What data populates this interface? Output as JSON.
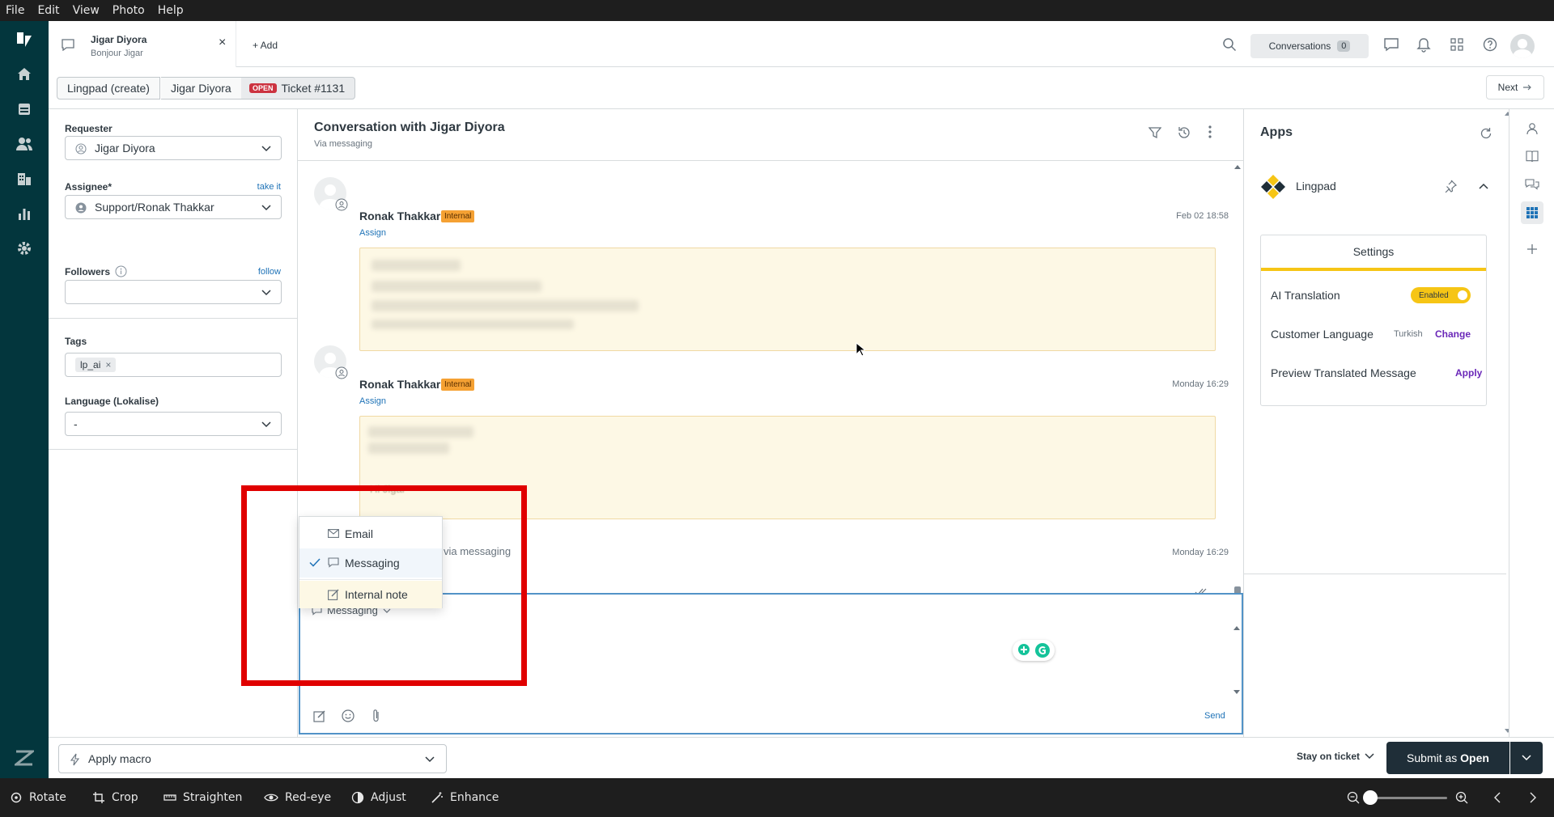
{
  "menubar": {
    "items": [
      "File",
      "Edit",
      "View",
      "Photo",
      "Help"
    ]
  },
  "topbar": {
    "tab": {
      "title": "Jigar Diyora",
      "subtitle": "Bonjour Jigar"
    },
    "add_label": "+ Add",
    "conversations_label": "Conversations",
    "conversations_count": "0"
  },
  "ticketbar": {
    "crumbs": [
      "Lingpad (create)",
      "Jigar Diyora"
    ],
    "status_badge": "OPEN",
    "ticket_label": "Ticket #1131",
    "next_label": "Next"
  },
  "left_panel": {
    "requester_label": "Requester",
    "requester_value": "Jigar Diyora",
    "assignee_label": "Assignee*",
    "take_it": "take it",
    "assignee_value": "Support/Ronak Thakkar",
    "followers_label": "Followers",
    "follow_link": "follow",
    "tags_label": "Tags",
    "tag": "lp_ai",
    "language_label": "Language (Lokalise)",
    "language_value": "-"
  },
  "conversation": {
    "title": "Conversation with Jigar Diyora",
    "subtitle": "Via messaging",
    "messages": [
      {
        "author": "Ronak Thakkar",
        "badge": "Internal",
        "action": "Assign",
        "time": "Feb 02 18:58"
      },
      {
        "author": "Ronak Thakkar",
        "badge": "Internal",
        "action": "Assign",
        "time": "Monday 16:29",
        "visible_text": "Hi Jigar"
      },
      {
        "via": "via messaging",
        "time": "Monday 16:29"
      }
    ]
  },
  "channel_menu": {
    "items": [
      {
        "label": "Email",
        "selected": false
      },
      {
        "label": "Messaging",
        "selected": true
      },
      {
        "label": "Internal note",
        "selected": false
      }
    ]
  },
  "composer": {
    "channel_label": "Messaging",
    "send_label": "Send"
  },
  "apps_panel": {
    "title": "Apps",
    "app_name": "Lingpad",
    "settings_tab": "Settings",
    "rows": [
      {
        "label": "AI Translation",
        "badge": "Enabled"
      },
      {
        "label": "Customer Language",
        "value": "Turkish",
        "action": "Change"
      },
      {
        "label": "Preview Translated Message",
        "action": "Apply"
      }
    ]
  },
  "footer": {
    "macro_label": "Apply macro",
    "stay_label": "Stay on ticket",
    "submit_prefix": "Submit as ",
    "submit_status": "Open"
  },
  "bottombar": {
    "tools": [
      "Rotate",
      "Crop",
      "Straighten",
      "Red-eye",
      "Adjust",
      "Enhance"
    ]
  },
  "colors": {
    "nav_bg": "#03363d",
    "accent_blue": "#1f73b7",
    "internal_badge": "#f5a133",
    "status_open": "#cc3340",
    "enabled_yellow": "#f6c515",
    "submit_bg": "#1f2e38",
    "annotation_red": "#e00000"
  }
}
